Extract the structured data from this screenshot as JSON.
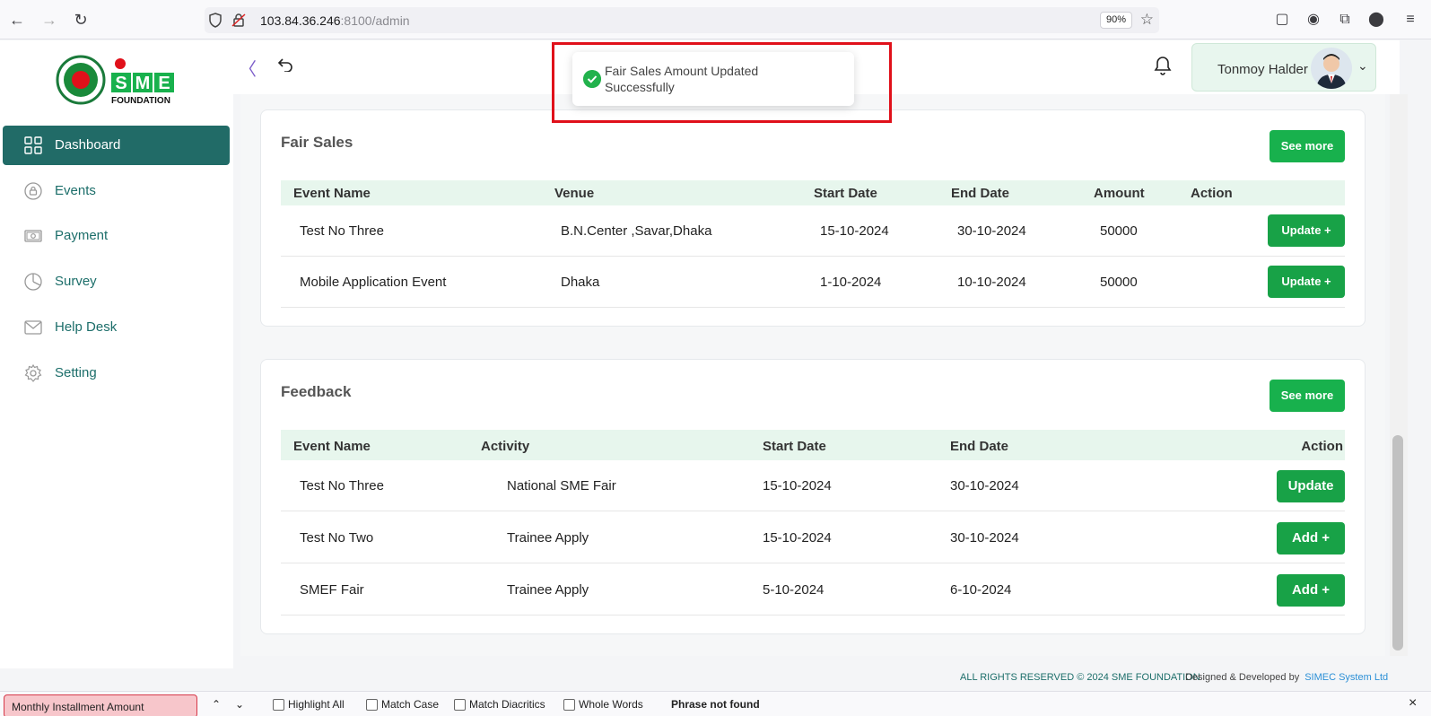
{
  "browser": {
    "url_host": "103.84.36.246",
    "url_path": ":8100/admin",
    "zoom": "90%"
  },
  "brand": {
    "logo_word": "SME",
    "logo_sub": "FOUNDATION",
    "accent": "#216b67",
    "green": "#18a247"
  },
  "sidebar": {
    "items": [
      {
        "label": "Dashboard",
        "icon": "grid-icon",
        "active": true
      },
      {
        "label": "Events",
        "icon": "lock-circle-icon"
      },
      {
        "label": "Payment",
        "icon": "money-icon"
      },
      {
        "label": "Survey",
        "icon": "pie-icon"
      },
      {
        "label": "Help Desk",
        "icon": "mail-icon"
      },
      {
        "label": "Setting",
        "icon": "gear-icon"
      }
    ]
  },
  "header": {
    "user_name": "Tonmoy Halder"
  },
  "toast": {
    "message": "Fair Sales Amount Updated Successfully"
  },
  "fair_sales": {
    "title": "Fair Sales",
    "see_more": "See more",
    "columns": [
      "Event Name",
      "Venue",
      "Start Date",
      "End Date",
      "Amount",
      "Action"
    ],
    "rows": [
      {
        "event": "Test No Three",
        "venue": "B.N.Center ,Savar,Dhaka",
        "start": "15-10-2024",
        "end": "30-10-2024",
        "amount": "50000",
        "action": "Update +"
      },
      {
        "event": "Mobile Application Event",
        "venue": "Dhaka",
        "start": "1-10-2024",
        "end": "10-10-2024",
        "amount": "50000",
        "action": "Update +"
      }
    ]
  },
  "feedback": {
    "title": "Feedback",
    "see_more": "See more",
    "columns": [
      "Event Name",
      "Activity",
      "Start Date",
      "End Date",
      "Action"
    ],
    "rows": [
      {
        "event": "Test No Three",
        "activity": "National SME Fair",
        "start": "15-10-2024",
        "end": "30-10-2024",
        "action": "Update"
      },
      {
        "event": "Test No Two",
        "activity": "Trainee Apply",
        "start": "15-10-2024",
        "end": "30-10-2024",
        "action": "Add +"
      },
      {
        "event": "SMEF Fair",
        "activity": "Trainee Apply",
        "start": "5-10-2024",
        "end": "6-10-2024",
        "action": "Add +"
      }
    ]
  },
  "footer": {
    "copyright": "ALL RIGHTS RESERVED © 2024 SME FOUNDATION",
    "designed_by": "Designed & Developed by",
    "developer": "SIMEC System Ltd"
  },
  "findbar": {
    "query": "Monthly Installment Amount",
    "highlight_all": "Highlight All",
    "match_case": "Match Case",
    "match_diacritics": "Match Diacritics",
    "whole_words": "Whole Words",
    "status": "Phrase not found"
  }
}
